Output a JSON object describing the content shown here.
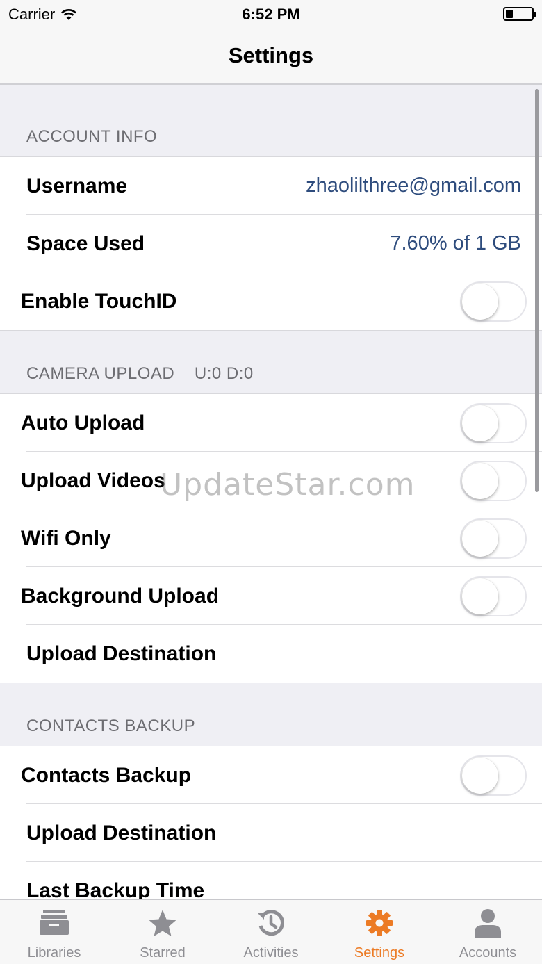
{
  "status": {
    "carrier": "Carrier",
    "time": "6:52 PM"
  },
  "nav": {
    "title": "Settings"
  },
  "sections": {
    "account": {
      "header": "ACCOUNT INFO",
      "username_label": "Username",
      "username_value": "zhaolilthree@gmail.com",
      "space_label": "Space Used",
      "space_value": "7.60% of 1 GB",
      "touchid_label": "Enable TouchID",
      "touchid_on": false
    },
    "camera": {
      "header": "CAMERA UPLOAD    U:0 D:0",
      "auto_upload_label": "Auto Upload",
      "upload_videos_label": "Upload Videos",
      "wifi_only_label": "Wifi Only",
      "background_upload_label": "Background Upload",
      "destination_label": "Upload Destination"
    },
    "contacts": {
      "header": "CONTACTS BACKUP",
      "backup_label": "Contacts Backup",
      "destination_label": "Upload Destination",
      "last_backup_label": "Last Backup Time"
    }
  },
  "watermark": "UpdateStar.com",
  "tabs": [
    {
      "label": "Libraries",
      "icon": "libraries-icon"
    },
    {
      "label": "Starred",
      "icon": "star-icon"
    },
    {
      "label": "Activities",
      "icon": "history-icon"
    },
    {
      "label": "Settings",
      "icon": "gear-icon",
      "active": true
    },
    {
      "label": "Accounts",
      "icon": "person-icon"
    }
  ],
  "colors": {
    "accent": "#ec7b25",
    "value_text": "#2e4c7d",
    "inactive_tab": "#8e8e93"
  }
}
